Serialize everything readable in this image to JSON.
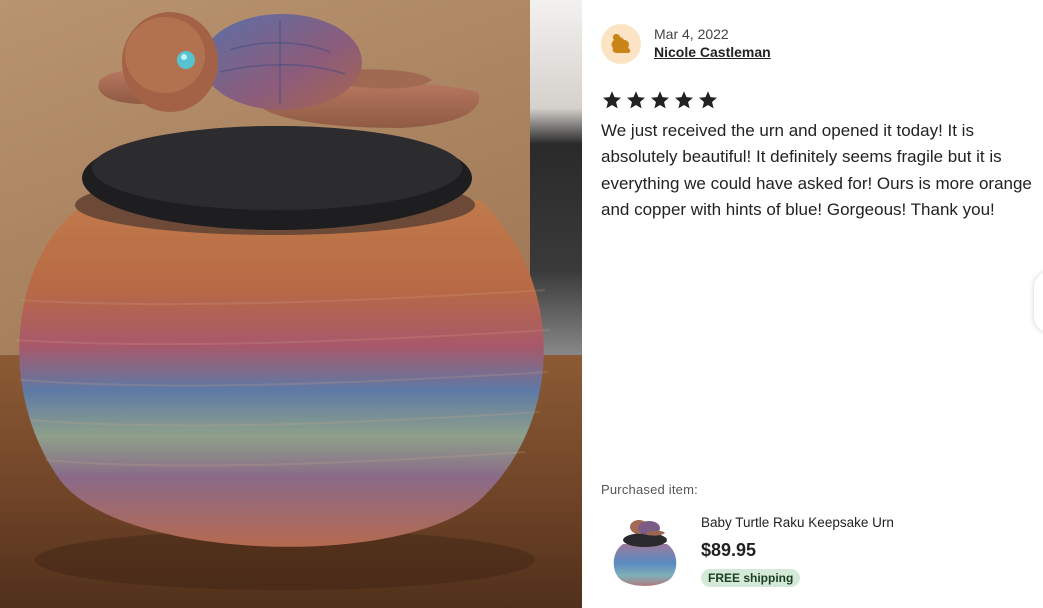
{
  "review": {
    "date": "Mar 4, 2022",
    "reviewer_name": "Nicole Castleman",
    "rating": 5,
    "text": "We just received the urn and opened it today! It is absolutely beautiful! It definitely seems fragile but it is everything we could have asked for! Ours is more orange and copper with hints of blue! Gorgeous! Thank you!"
  },
  "purchase": {
    "label": "Purchased item:",
    "item_title": "Baby Turtle Raku Keepsake Urn",
    "price": "$89.95",
    "shipping_badge": "FREE shipping"
  },
  "icons": {
    "avatar": "user-avatar-icon",
    "star": "star-icon"
  },
  "colors": {
    "avatar_bg": "#fbe3c3",
    "avatar_fg": "#c98518",
    "star": "#222222",
    "badge_bg": "#d4e9d7"
  }
}
